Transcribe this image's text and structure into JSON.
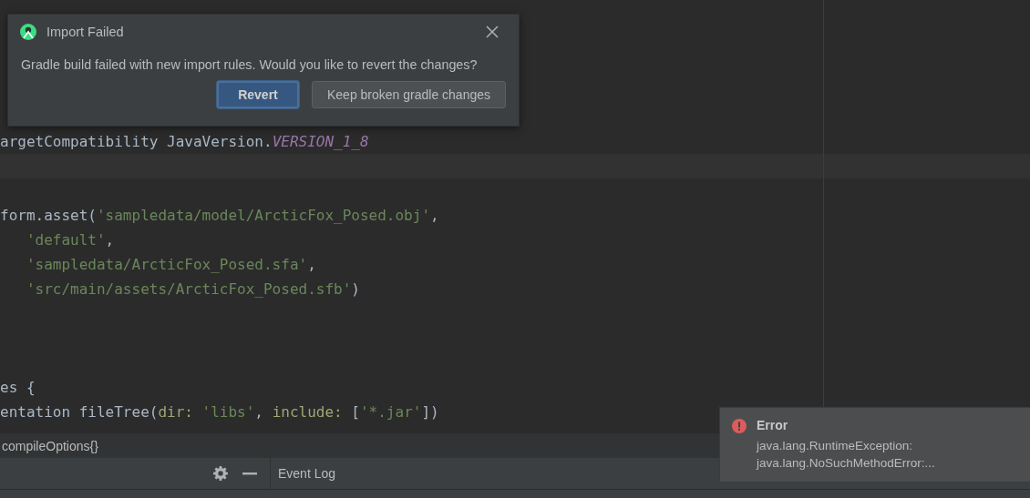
{
  "editor": {
    "lines": [
      {
        "kind": "blank"
      },
      {
        "kind": "blank"
      },
      {
        "kind": "code",
        "tokens": [
          {
            "kind": "plain",
            "text": "argetCompatibility JavaVersion."
          },
          {
            "kind": "constant",
            "text": "VERSION_1_8"
          }
        ]
      },
      {
        "kind": "current"
      },
      {
        "kind": "blank"
      },
      {
        "kind": "code",
        "tokens": [
          {
            "kind": "plain",
            "text": "form.asset("
          },
          {
            "kind": "string",
            "text": "'sampledata/model/ArcticFox_Posed.obj'"
          },
          {
            "kind": "plain",
            "text": ","
          }
        ]
      },
      {
        "kind": "code",
        "tokens": [
          {
            "kind": "string",
            "text": "   'default'"
          },
          {
            "kind": "plain",
            "text": ","
          }
        ]
      },
      {
        "kind": "code",
        "tokens": [
          {
            "kind": "string",
            "text": "   'sampledata/ArcticFox_Posed.sfa'"
          },
          {
            "kind": "plain",
            "text": ","
          }
        ]
      },
      {
        "kind": "code",
        "tokens": [
          {
            "kind": "string",
            "text": "   'src/main/assets/ArcticFox_Posed.sfb'"
          },
          {
            "kind": "plain",
            "text": ")"
          }
        ]
      },
      {
        "kind": "blank"
      },
      {
        "kind": "blank"
      },
      {
        "kind": "blank"
      },
      {
        "kind": "code",
        "tokens": [
          {
            "kind": "plain",
            "text": "es {"
          }
        ]
      },
      {
        "kind": "code",
        "tokens": [
          {
            "kind": "plain",
            "text": "entation fileTree("
          },
          {
            "kind": "param",
            "text": "dir: "
          },
          {
            "kind": "string",
            "text": "'libs'"
          },
          {
            "kind": "plain",
            "text": ", "
          },
          {
            "kind": "param",
            "text": "include: "
          },
          {
            "kind": "plain",
            "text": "["
          },
          {
            "kind": "string",
            "text": "'*.jar'"
          },
          {
            "kind": "plain",
            "text": "])"
          }
        ]
      }
    ]
  },
  "breadcrumb": "compileOptions{}",
  "tool_window": {
    "title": "Event Log"
  },
  "dialog": {
    "title": "Import Failed",
    "message": "Gradle build failed with new import rules.  Would you like to revert the changes?",
    "buttons": [
      {
        "label": "Revert",
        "default": true
      },
      {
        "label": "Keep broken gradle changes",
        "default": false
      }
    ]
  },
  "notification": {
    "title": "Error",
    "lines": [
      "java.lang.RuntimeException:",
      "java.lang.NoSuchMethodError:..."
    ]
  }
}
